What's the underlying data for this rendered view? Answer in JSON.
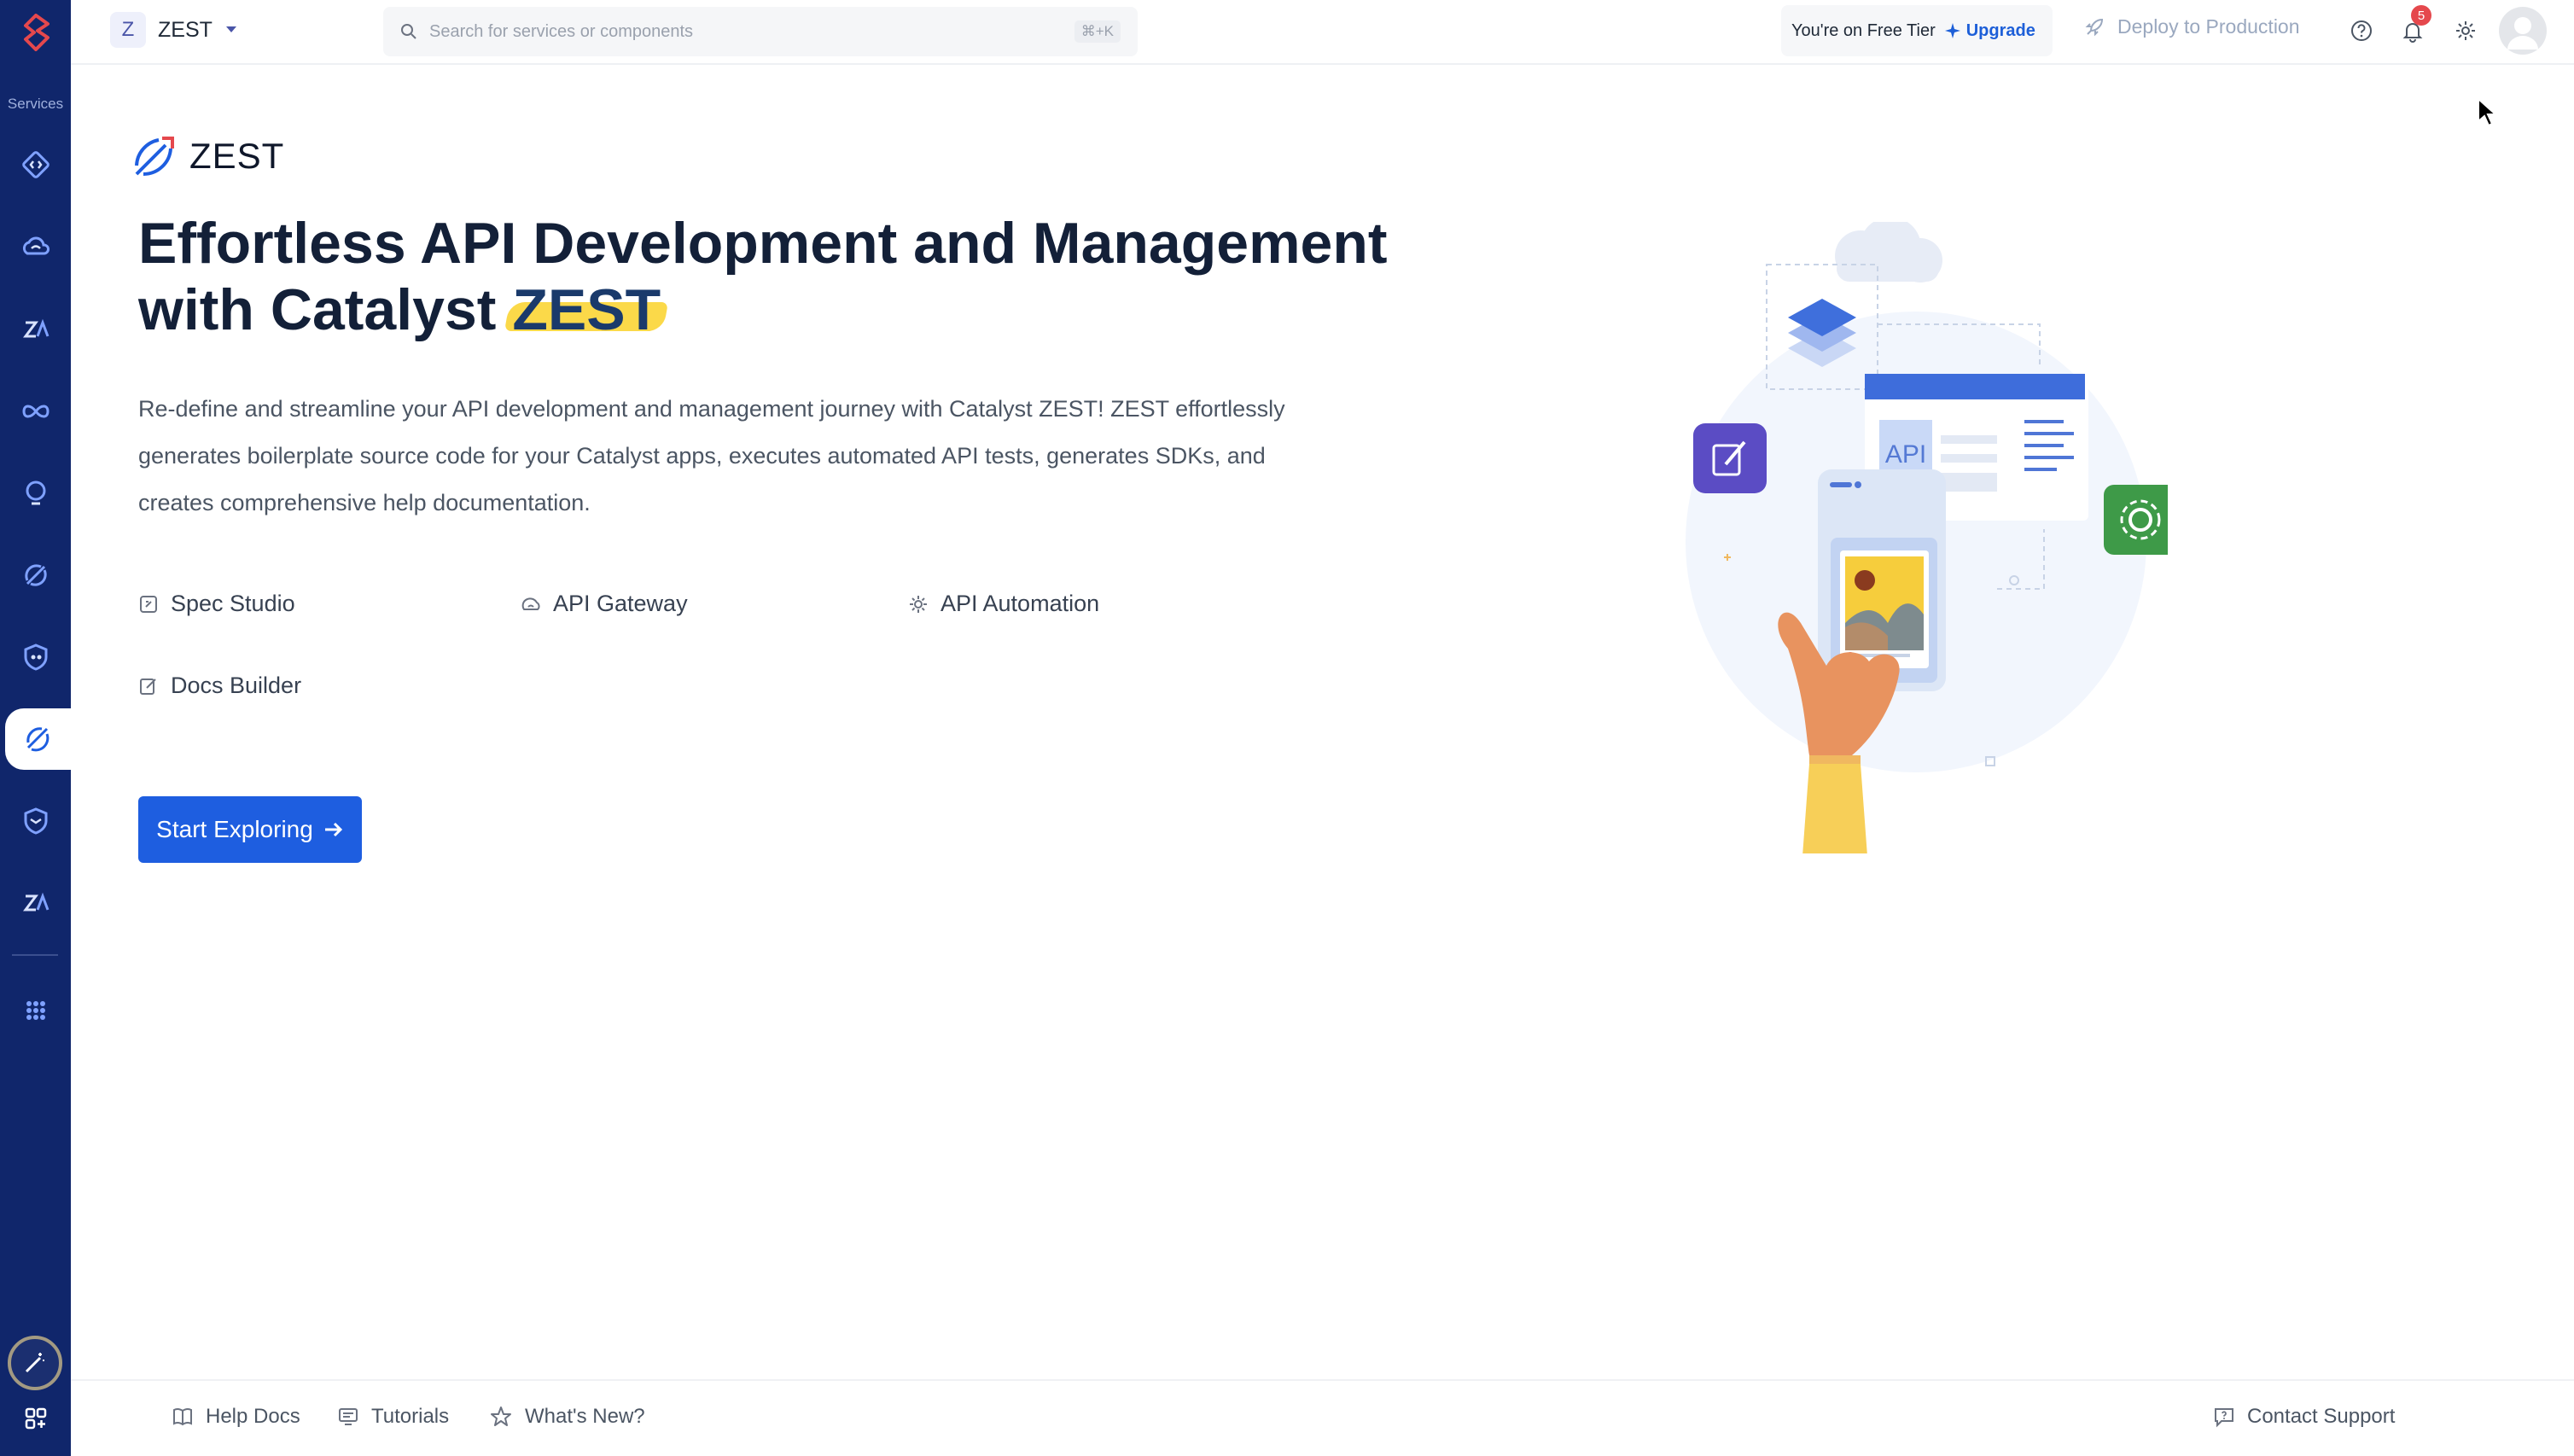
{
  "sidebar": {
    "section_label": "Services"
  },
  "topbar": {
    "project_initial": "Z",
    "project_name": "ZEST",
    "search_placeholder": "Search for services or components",
    "search_shortcut": "⌘+K",
    "tier_text": "You're on Free Tier",
    "upgrade_label": "Upgrade",
    "deploy_label": "Deploy to Production",
    "notification_count": "5"
  },
  "main": {
    "brand_name": "ZEST",
    "headline_line1": "Effortless API Development and Management",
    "headline_line2_prefix": "with Catalyst",
    "headline_highlight": "ZEST",
    "description": "Re-define and streamline your API development and management journey with Catalyst ZEST! ZEST effortlessly generates boilerplate source code for your Catalyst apps, executes automated API tests, generates SDKs, and creates comprehensive help documentation.",
    "features": [
      "Spec Studio",
      "API Gateway",
      "API Automation",
      "Docs Builder"
    ],
    "cta_label": "Start Exploring",
    "illustration_label": "API"
  },
  "footer": {
    "help_docs": "Help Docs",
    "tutorials": "Tutorials",
    "whats_new": "What's New?",
    "contact_support": "Contact Support"
  },
  "colors": {
    "sidebar_bg": "#10266b",
    "primary": "#1e5ee0",
    "highlight": "#fbd949",
    "edit_tile": "#5b4cc4",
    "settings_tile": "#3e9a48"
  }
}
